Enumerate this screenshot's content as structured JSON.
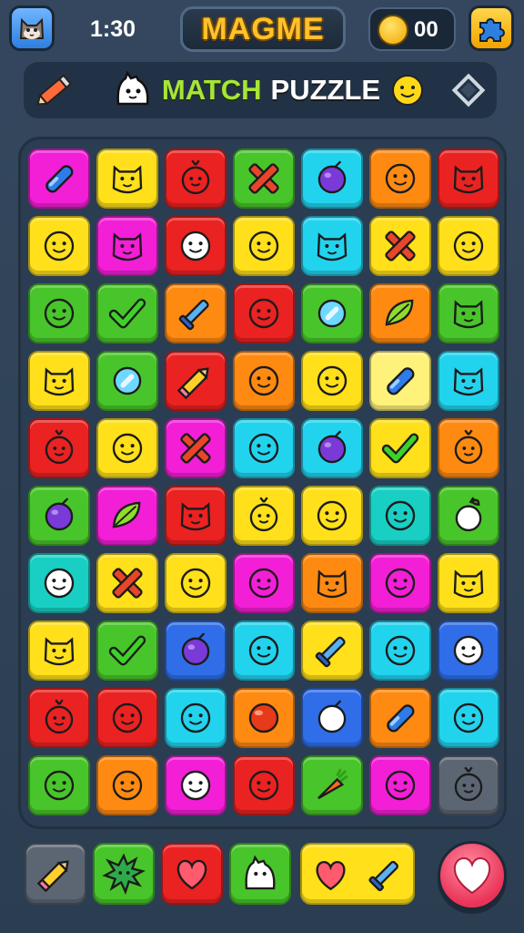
{
  "header": {
    "time": "1:30",
    "title": "MAGME",
    "coins": "00",
    "icons": {
      "avatar": "cat-avatar-icon",
      "coin": "coin-icon",
      "settings": "puzzle-piece-icon"
    }
  },
  "banner": {
    "word1": "MATCH",
    "word2": "PUZZLE",
    "icons": {
      "left": "pencil-icon",
      "mascot": "ghost-mascot-icon",
      "smiley": "smiley-icon",
      "right": "diamond-icon"
    }
  },
  "palette": {
    "magenta": "#f21fd6",
    "yellow": "#ffe01a",
    "red": "#ea2222",
    "green": "#48c52a",
    "cyan": "#22d3ee",
    "orange": "#ff8a12",
    "blue": "#2f6ee8",
    "teal": "#19cfc3",
    "lightyellow": "#fff27a",
    "darkred": "#c11c1c",
    "gray": "#5c6673"
  },
  "board": {
    "columns": 7,
    "rows": [
      [
        {
          "bg": "magenta",
          "icon": "bar"
        },
        {
          "bg": "yellow",
          "icon": "cat-face"
        },
        {
          "bg": "red",
          "icon": "berry"
        },
        {
          "bg": "green",
          "icon": "cross"
        },
        {
          "bg": "cyan",
          "icon": "grape"
        },
        {
          "bg": "orange",
          "icon": "face"
        },
        {
          "bg": "red",
          "icon": "cat-face"
        }
      ],
      [
        {
          "bg": "yellow",
          "icon": "face"
        },
        {
          "bg": "magenta",
          "icon": "cat-face"
        },
        {
          "bg": "red",
          "icon": "white-face"
        },
        {
          "bg": "yellow",
          "icon": "face"
        },
        {
          "bg": "cyan",
          "icon": "cat-face"
        },
        {
          "bg": "yellow",
          "icon": "cross"
        },
        {
          "bg": "yellow",
          "icon": "face"
        }
      ],
      [
        {
          "bg": "green",
          "icon": "face"
        },
        {
          "bg": "green",
          "icon": "check"
        },
        {
          "bg": "orange",
          "icon": "sword"
        },
        {
          "bg": "red",
          "icon": "face"
        },
        {
          "bg": "green",
          "icon": "gem"
        },
        {
          "bg": "orange",
          "icon": "leaf"
        },
        {
          "bg": "green",
          "icon": "cat-face"
        }
      ],
      [
        {
          "bg": "yellow",
          "icon": "cat-face"
        },
        {
          "bg": "green",
          "icon": "gem"
        },
        {
          "bg": "red",
          "icon": "pencil"
        },
        {
          "bg": "orange",
          "icon": "face"
        },
        {
          "bg": "yellow",
          "icon": "face"
        },
        {
          "bg": "lightyellow",
          "icon": "bar"
        },
        {
          "bg": "cyan",
          "icon": "cat-face"
        }
      ],
      [
        {
          "bg": "red",
          "icon": "berry"
        },
        {
          "bg": "yellow",
          "icon": "face"
        },
        {
          "bg": "magenta",
          "icon": "cross"
        },
        {
          "bg": "cyan",
          "icon": "face"
        },
        {
          "bg": "cyan",
          "icon": "grape"
        },
        {
          "bg": "yellow",
          "icon": "check"
        },
        {
          "bg": "orange",
          "icon": "berry"
        }
      ],
      [
        {
          "bg": "green",
          "icon": "grape"
        },
        {
          "bg": "magenta",
          "icon": "leaf"
        },
        {
          "bg": "red",
          "icon": "cat-face"
        },
        {
          "bg": "yellow",
          "icon": "berry"
        },
        {
          "bg": "yellow",
          "icon": "face"
        },
        {
          "bg": "teal",
          "icon": "face"
        },
        {
          "bg": "green",
          "icon": "white-berry"
        }
      ],
      [
        {
          "bg": "teal",
          "icon": "white-face"
        },
        {
          "bg": "yellow",
          "icon": "cross"
        },
        {
          "bg": "yellow",
          "icon": "face"
        },
        {
          "bg": "magenta",
          "icon": "face"
        },
        {
          "bg": "orange",
          "icon": "cat-face"
        },
        {
          "bg": "magenta",
          "icon": "face"
        },
        {
          "bg": "yellow",
          "icon": "cat-face"
        }
      ],
      [
        {
          "bg": "yellow",
          "icon": "cat-face"
        },
        {
          "bg": "green",
          "icon": "check"
        },
        {
          "bg": "blue",
          "icon": "grape"
        },
        {
          "bg": "cyan",
          "icon": "face"
        },
        {
          "bg": "yellow",
          "icon": "sword"
        },
        {
          "bg": "cyan",
          "icon": "face"
        },
        {
          "bg": "blue",
          "icon": "white-face"
        }
      ],
      [
        {
          "bg": "red",
          "icon": "berry"
        },
        {
          "bg": "red",
          "icon": "face"
        },
        {
          "bg": "cyan",
          "icon": "face"
        },
        {
          "bg": "orange",
          "icon": "ball"
        },
        {
          "bg": "blue",
          "icon": "white-ball"
        },
        {
          "bg": "orange",
          "icon": "bar"
        },
        {
          "bg": "cyan",
          "icon": "face"
        }
      ],
      [
        {
          "bg": "green",
          "icon": "face"
        },
        {
          "bg": "orange",
          "icon": "face"
        },
        {
          "bg": "magenta",
          "icon": "white-face"
        },
        {
          "bg": "red",
          "icon": "face"
        },
        {
          "bg": "green",
          "icon": "carrot"
        },
        {
          "bg": "magenta",
          "icon": "face"
        },
        {
          "bg": "gray",
          "icon": "berry"
        }
      ]
    ]
  },
  "tray": {
    "items": [
      {
        "bg": "gray",
        "icon": "pencil"
      },
      {
        "bg": "green",
        "icon": "splat"
      },
      {
        "bg": "red",
        "icon": "heart"
      },
      {
        "bg": "green",
        "icon": "ghost"
      }
    ],
    "combo": {
      "bg": "yellow",
      "icons": [
        "heart",
        "sword"
      ]
    },
    "like_icon": "heart-icon"
  }
}
